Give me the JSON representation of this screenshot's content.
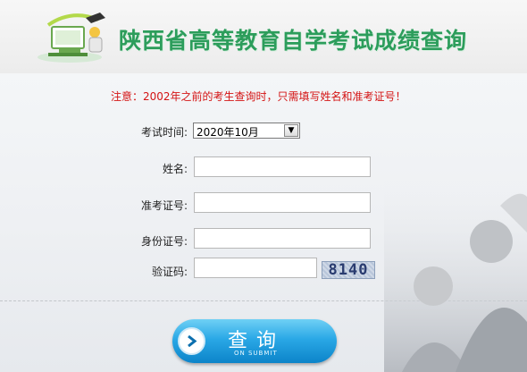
{
  "header": {
    "title": "陕西省高等教育自学考试成绩查询",
    "logo_icon": "computer-graduation-icon",
    "title_color": "#2c9d5b"
  },
  "notice": "注意：2002年之前的考生查询时，只需填写姓名和准考证号！",
  "notice_color": "#d41414",
  "form": {
    "exam_time_label": "考试时间:",
    "exam_time_value": "2020年10月",
    "name_label": "姓名:",
    "name_value": "",
    "ticket_label": "准考证号:",
    "ticket_value": "",
    "id_label": "身份证号:",
    "id_value": "",
    "captcha_label": "验证码:",
    "captcha_value": "",
    "captcha_text": "8140"
  },
  "submit": {
    "label": "查询",
    "sub_label": "ON SUBMIT",
    "color": "#2aa8e6"
  }
}
